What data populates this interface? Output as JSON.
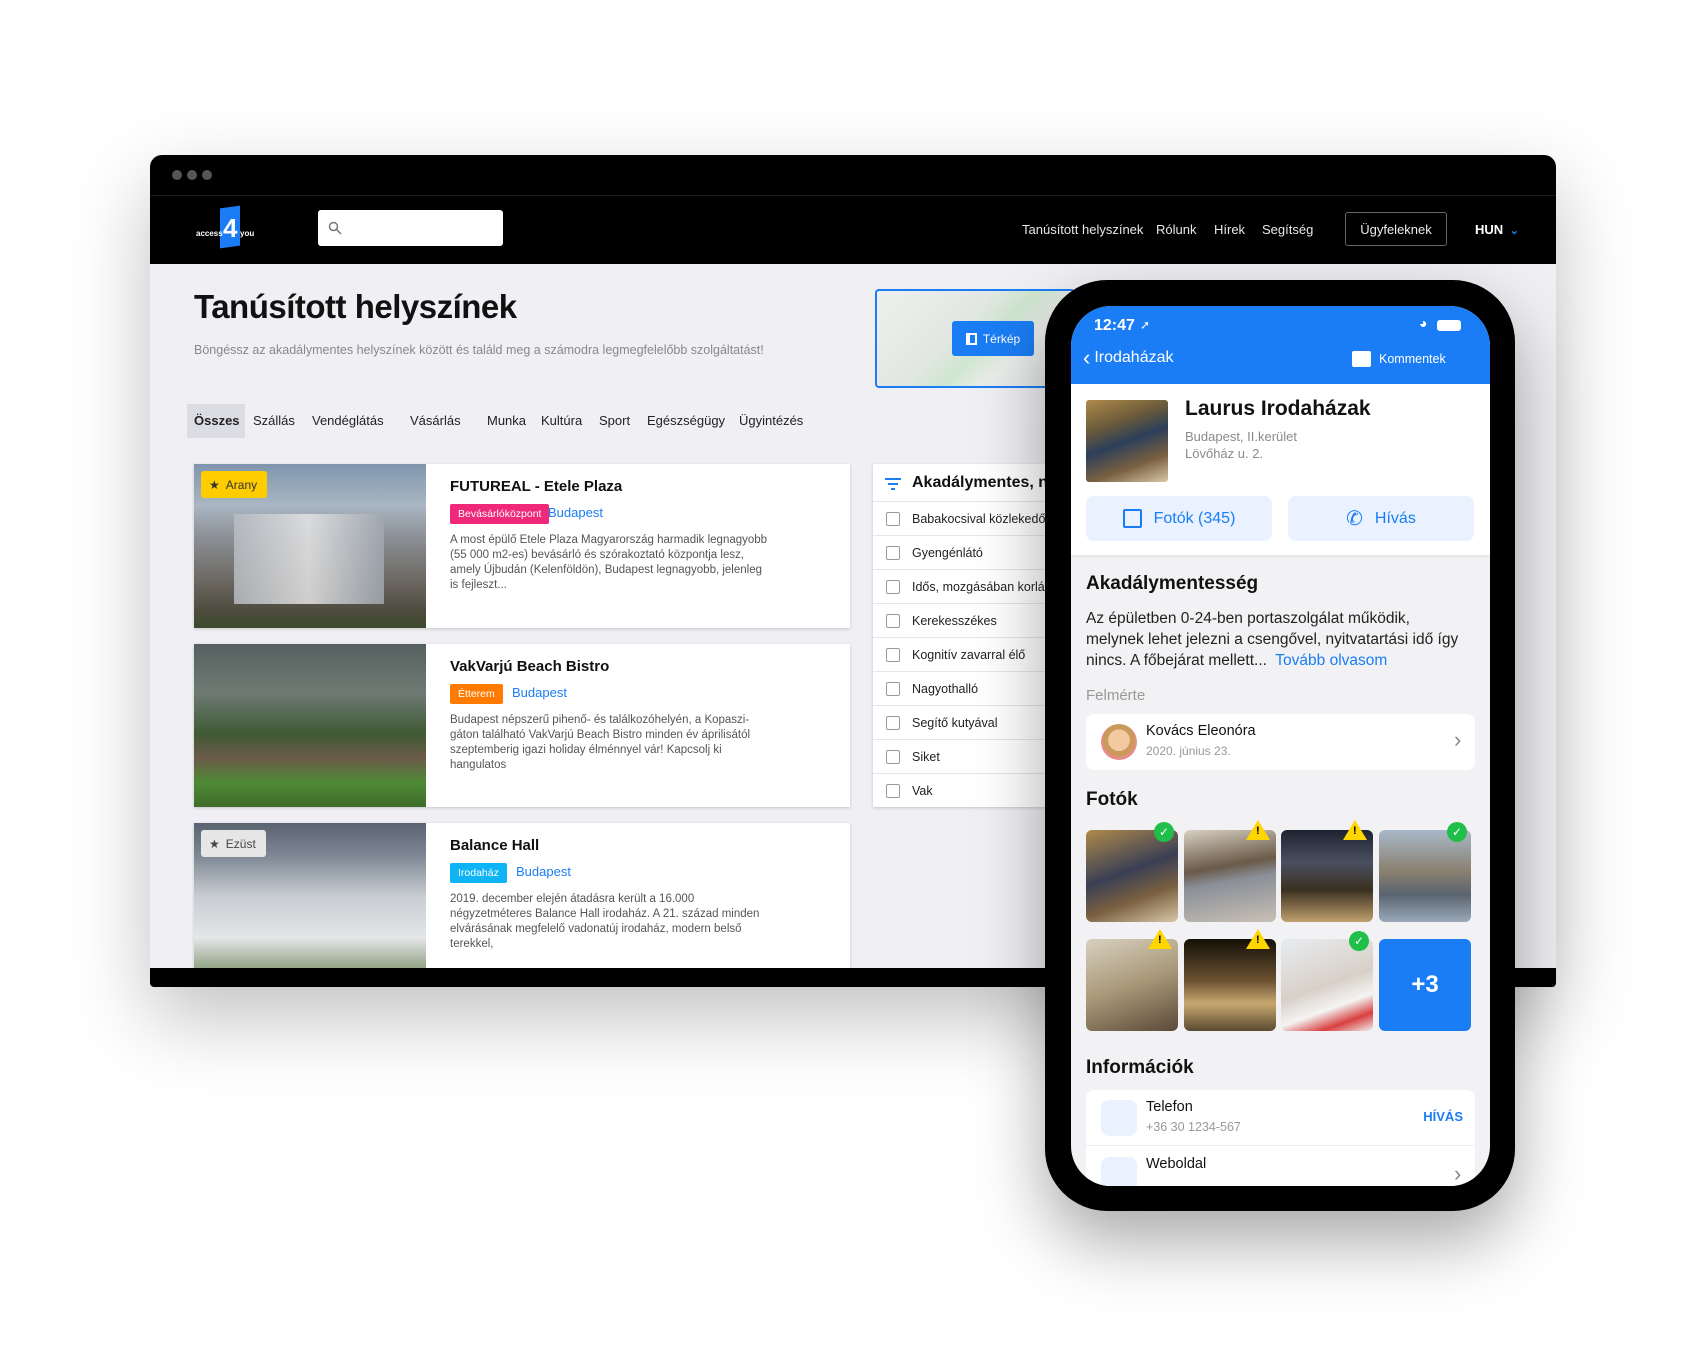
{
  "browser": {
    "logo": {
      "text_left": "access",
      "numeral": "4",
      "text_right": "you"
    },
    "search": {
      "placeholder": "",
      "value": ""
    },
    "nav": {
      "links": [
        "Tanúsított helyszínek",
        "Rólunk",
        "Hírek",
        "Segítség"
      ],
      "client_button": "Ügyfeleknek",
      "language": "HUN"
    },
    "page": {
      "title": "Tanúsított helyszínek",
      "subtitle": "Böngéssz az akadálymentes helyszínek között és találd meg a számodra legmegfelelőbb szolgáltatást!"
    },
    "map_button": "Térkép",
    "tabs": [
      "Összes",
      "Szállás",
      "Vendéglátás",
      "Vásárlás",
      "Munka",
      "Kultúra",
      "Sport",
      "Egészségügy",
      "Ügyintézés"
    ],
    "active_tab": "Összes",
    "cards": [
      {
        "title": "FUTUREAL - Etele Plaza",
        "medal": "Arany",
        "category": "Bevásárlóközpont",
        "category_color": "#f0287a",
        "city": "Budapest",
        "description": "A most épülő Etele Plaza Magyarország harmadik legnagyobb (55 000 m2-es) bevásárló és szórakoztató központja lesz, amely Újbudán (Kelenföldön), Budapest legnagyobb, jelenleg is fejleszt..."
      },
      {
        "title": "VakVarjú Beach Bistro",
        "medal": "",
        "category": "Étterem",
        "category_color": "#ff7a00",
        "city": "Budapest",
        "description": "Budapest népszerű pihenő- és találkozóhelyén, a Kopaszi-gáton található VakVarjú Beach Bistro minden év áprilisától szeptemberig igazi holiday élménnyel vár! Kapcsolj ki hangulatos"
      },
      {
        "title": "Balance Hall",
        "medal": "Ezüst",
        "category": "Irodaház",
        "category_color": "#0fb4f5",
        "city": "Budapest",
        "description": "2019. december elején átadásra került a 16.000 négyzetméteres Balance Hall irodaház. A 21. század minden elvárásának megfelelő vadonatúj irodaház, modern belső terekkel,"
      }
    ],
    "filter": {
      "title": "Akadálymentes, n",
      "options": [
        "Babakocsival közlekedő",
        "Gyengénlátó",
        "Idős, mozgásában korlátozott",
        "Kerekesszékes",
        "Kognitív zavarral élő",
        "Nagyothalló",
        "Segítő kutyával",
        "Siket",
        "Vak"
      ]
    }
  },
  "phone": {
    "status_time": "12:47",
    "back_label": "Irodaházak",
    "comments_label": "Kommentek",
    "place": {
      "name": "Laurus Irodaházak",
      "district": "Budapest, II.kerület",
      "address": "Lövőház u. 2."
    },
    "photos_button": "Fotók (345)",
    "call_button": "Hívás",
    "accessibility": {
      "heading": "Akadálymentesség",
      "text": "Az épületben 0-24-ben portaszolgálat működik, melynek lehet jelezni a csengővel, nyitvatartási idő így nincs. A főbejárat mellett...",
      "read_more": "Tovább olvasom"
    },
    "surveyed_label": "Felmérte",
    "surveyor": {
      "name": "Kovács Eleonóra",
      "date": "2020. június 23."
    },
    "photos_heading": "Fotók",
    "photo_status": [
      "ok",
      "warning",
      "warning",
      "ok",
      "warning",
      "warning",
      "ok"
    ],
    "more_photos": "+3",
    "info_heading": "Információk",
    "info": [
      {
        "label": "Telefon",
        "value": "+36 30 1234-567",
        "action": "HÍVÁS"
      },
      {
        "label": "Weboldal",
        "value": ""
      }
    ],
    "accent_color": "#1a7df5"
  }
}
